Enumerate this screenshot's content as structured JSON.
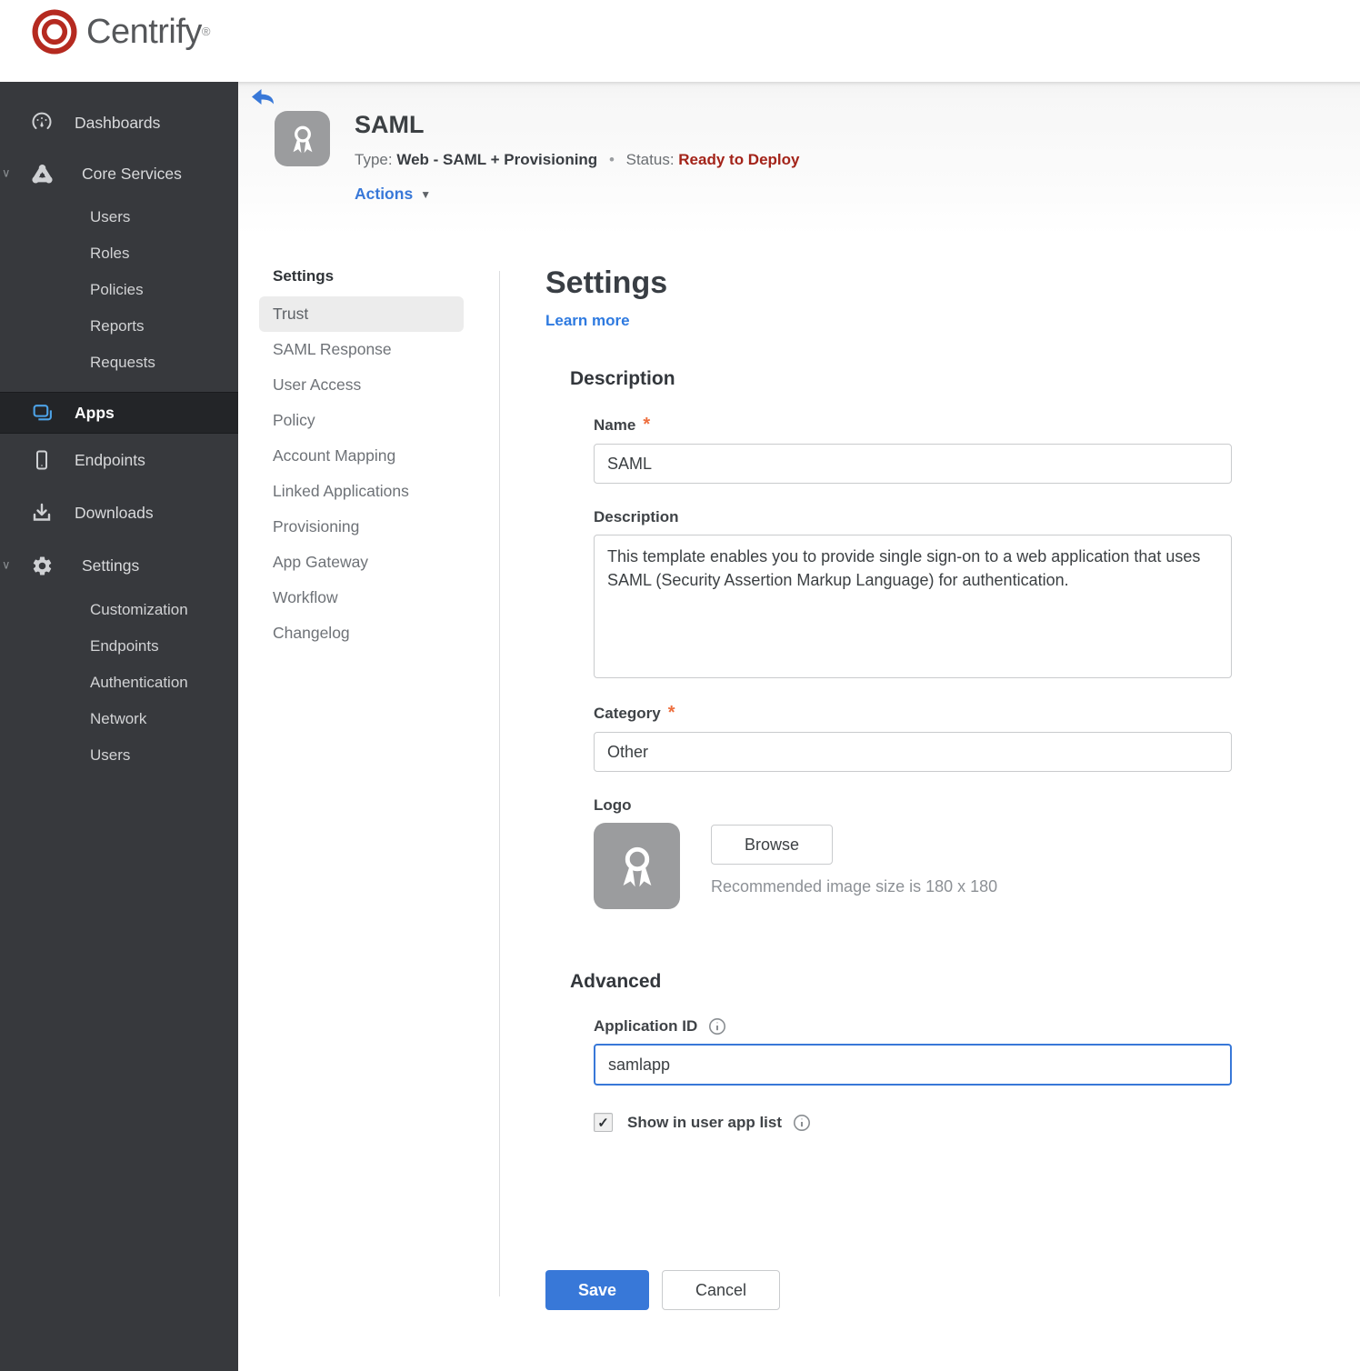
{
  "brand": {
    "name": "Centrify",
    "reg": "®"
  },
  "sidebar": {
    "dashboards": "Dashboards",
    "core_services": "Core Services",
    "core_children": [
      "Users",
      "Roles",
      "Policies",
      "Reports",
      "Requests"
    ],
    "apps": "Apps",
    "endpoints": "Endpoints",
    "downloads": "Downloads",
    "settings": "Settings",
    "settings_children": [
      "Customization",
      "Endpoints",
      "Authentication",
      "Network",
      "Users"
    ]
  },
  "app_header": {
    "title": "SAML",
    "type_label": "Type:",
    "type_value": "Web - SAML + Provisioning",
    "separator": "•",
    "status_label": "Status:",
    "status_value": "Ready to Deploy",
    "actions_label": "Actions"
  },
  "settings_nav": {
    "header": "Settings",
    "selected": "Trust",
    "items": [
      "Trust",
      "SAML Response",
      "User Access",
      "Policy",
      "Account Mapping",
      "Linked Applications",
      "Provisioning",
      "App Gateway",
      "Workflow",
      "Changelog"
    ]
  },
  "form": {
    "title": "Settings",
    "learn_more": "Learn more",
    "description_section": "Description",
    "name_label": "Name",
    "name_value": "SAML",
    "description_label": "Description",
    "description_value": "This template enables you to provide single sign-on to a web application that uses SAML (Security Assertion Markup Language) for authentication.",
    "category_label": "Category",
    "category_value": "Other",
    "logo_label": "Logo",
    "browse_label": "Browse",
    "logo_hint": "Recommended image size is 180 x 180",
    "advanced_section": "Advanced",
    "application_id_label": "Application ID",
    "application_id_value": "samlapp",
    "show_in_app_list_label": "Show in user app list",
    "show_in_app_list_checked": true,
    "save_label": "Save",
    "cancel_label": "Cancel",
    "required_marker": "*"
  },
  "icons": {
    "checkmark": "✓",
    "caret_down": "▼",
    "chevron_down": "∨"
  },
  "colors": {
    "accent_blue": "#3878d8",
    "status_red": "#a32319",
    "required_orange": "#ee6f3f",
    "sidebar_bg": "#37393d",
    "apps_icon_blue": "#4da3e8"
  }
}
